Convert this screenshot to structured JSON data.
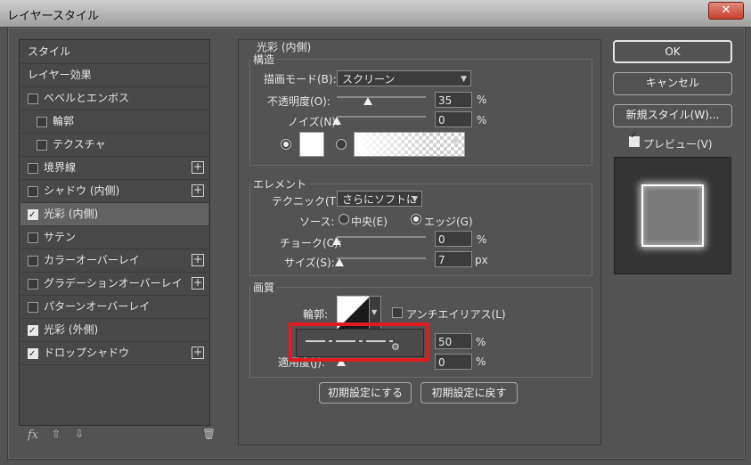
{
  "window": {
    "title": "レイヤースタイル",
    "close_label": "✕"
  },
  "left_panel": {
    "items": [
      {
        "label": "スタイル",
        "has_check": false,
        "checked": false,
        "indent": 0,
        "plus": false,
        "selected": false
      },
      {
        "label": "レイヤー効果",
        "has_check": false,
        "checked": false,
        "indent": 0,
        "plus": false,
        "selected": false
      },
      {
        "label": "ベベルとエンボス",
        "has_check": true,
        "checked": false,
        "indent": 0,
        "plus": false,
        "selected": false
      },
      {
        "label": "輪郭",
        "has_check": true,
        "checked": false,
        "indent": 1,
        "plus": false,
        "selected": false
      },
      {
        "label": "テクスチャ",
        "has_check": true,
        "checked": false,
        "indent": 1,
        "plus": false,
        "selected": false
      },
      {
        "label": "境界線",
        "has_check": true,
        "checked": false,
        "indent": 0,
        "plus": true,
        "selected": false
      },
      {
        "label": "シャドウ (内側)",
        "has_check": true,
        "checked": false,
        "indent": 0,
        "plus": true,
        "selected": false
      },
      {
        "label": "光彩 (内側)",
        "has_check": true,
        "checked": true,
        "indent": 0,
        "plus": false,
        "selected": true
      },
      {
        "label": "サテン",
        "has_check": true,
        "checked": false,
        "indent": 0,
        "plus": false,
        "selected": false
      },
      {
        "label": "カラーオーバーレイ",
        "has_check": true,
        "checked": false,
        "indent": 0,
        "plus": true,
        "selected": false
      },
      {
        "label": "グラデーションオーバーレイ",
        "has_check": true,
        "checked": false,
        "indent": 0,
        "plus": true,
        "selected": false
      },
      {
        "label": "パターンオーバーレイ",
        "has_check": true,
        "checked": false,
        "indent": 0,
        "plus": false,
        "selected": false
      },
      {
        "label": "光彩 (外側)",
        "has_check": true,
        "checked": true,
        "indent": 0,
        "plus": false,
        "selected": false
      },
      {
        "label": "ドロップシャドウ",
        "has_check": true,
        "checked": true,
        "indent": 0,
        "plus": true,
        "selected": false
      }
    ],
    "footer": {
      "fx": "fx",
      "up": "⇧",
      "down": "⇩",
      "trash": "🗑"
    }
  },
  "inner_glow": {
    "group_title": "光彩 (内側)",
    "structure": {
      "title": "構造",
      "blend_mode_label": "描画モード(B):",
      "blend_mode_value": "スクリーン",
      "opacity_label": "不透明度(O):",
      "opacity_value": "35",
      "opacity_fraction": 0.35,
      "noise_label": "ノイズ(N):",
      "noise_value": "0",
      "noise_fraction": 0,
      "percent": "%",
      "color_mode": "solid"
    },
    "elements": {
      "title": "エレメント",
      "technique_label": "テクニック(T):",
      "technique_value": "さらにソフトに",
      "source_label": "ソース:",
      "source_center_label": "中央(E)",
      "source_edge_label": "エッジ(G)",
      "source_selected": "edge",
      "choke_label": "チョーク(C):",
      "choke_value": "0",
      "choke_fraction": 0,
      "size_label": "サイズ(S):",
      "size_value": "7",
      "size_fraction": 0.03,
      "percent": "%",
      "px": "px"
    },
    "quality": {
      "title": "画質",
      "contour_label": "輪郭:",
      "antialias_label": "アンチエイリアス(L)",
      "antialias_checked": false,
      "range_value": "50",
      "jitter_label": "適用度(J):",
      "jitter_value": "0",
      "percent": "%"
    },
    "make_default_label": "初期設定にする",
    "reset_default_label": "初期設定に戻す"
  },
  "right": {
    "ok_label": "OK",
    "cancel_label": "キャンセル",
    "new_style_label": "新規スタイル(W)...",
    "preview_label": "プレビュー(V)",
    "preview_checked": true
  },
  "colors": {
    "highlight": "#e01c22",
    "panel": "#535353"
  }
}
